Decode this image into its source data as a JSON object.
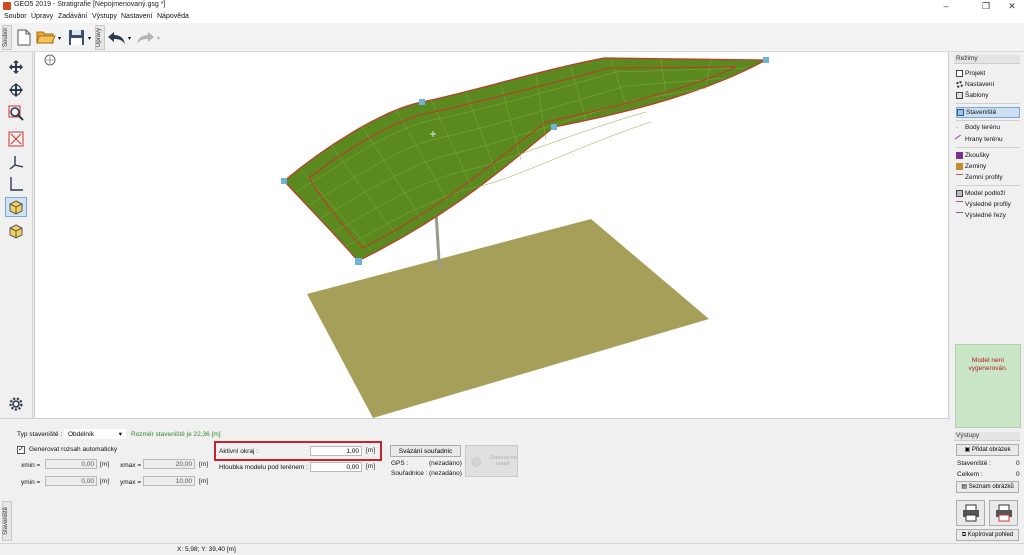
{
  "window": {
    "title": "GEO5 2019 - Stratigrafie [Nepojmenovaný.gsg *]"
  },
  "menu": [
    "Soubor",
    "Úpravy",
    "Zadávání",
    "Výstupy",
    "Nastavení",
    "Nápověda"
  ],
  "toolbar": {
    "tab_file": "Soubor",
    "tab_edit": "Úpravy"
  },
  "right_panel": {
    "header": "Režimy",
    "items": [
      {
        "label": "Projekt",
        "icon": "project-icon"
      },
      {
        "label": "Nastavení",
        "icon": "gear-icon"
      },
      {
        "label": "Šablony",
        "icon": "template-icon"
      },
      {
        "label": "Staveniště",
        "icon": "site-icon",
        "active": true
      },
      {
        "label": "Body terénu",
        "icon": "terrain-point-icon"
      },
      {
        "label": "Hrany terénu",
        "icon": "terrain-edge-icon"
      },
      {
        "label": "Zkoušky",
        "icon": "borehole-icon"
      },
      {
        "label": "Zeminy",
        "icon": "soil-icon"
      },
      {
        "label": "Zemní profily",
        "icon": "soil-profile-icon"
      },
      {
        "label": "Model podloží",
        "icon": "subsoil-model-icon"
      },
      {
        "label": "Výsledné profily",
        "icon": "result-profile-icon"
      },
      {
        "label": "Výsledné řezy",
        "icon": "result-section-icon"
      }
    ],
    "model_status": "Model není vygenerován."
  },
  "bottom_panel": {
    "vtab": "Staveniště",
    "site_type_label": "Typ staveniště :",
    "site_type_value": "Obdélník",
    "site_size_info": "Rozměr staveniště je 22,36 [m]",
    "auto_checkbox_label": "Generovat rozsah automaticky",
    "xmin_label": "xmin =",
    "xmin_value": "0,00",
    "xmax_label": "xmax =",
    "xmax_value": "20,00",
    "ymin_label": "ymin =",
    "ymin_value": "0,00",
    "ymax_label": "ymax =",
    "ymax_value": "10,00",
    "unit_m": "[m]",
    "active_margin_label": "Aktivní okraj :",
    "active_margin_value": "1,00",
    "depth_label": "Hloubka modelu pod terénem :",
    "depth_value": "0,00",
    "coords_button": "Svázání souřadnic",
    "gps_label": "GPS :",
    "gps_value": "(nezadáno)",
    "coords_label": "Souřadnice :",
    "coords_value": "(nezadáno)",
    "map_button": "Zobrazit na mapě"
  },
  "outputs_panel": {
    "header": "Výstupy",
    "add_image": "Přidat obrázek",
    "site_label": "Staveniště :",
    "site_count": "0",
    "total_label": "Celkem :",
    "total_count": "0",
    "image_list": "Seznam obrázků",
    "copy_view": "Kopírovat pohled"
  },
  "status": {
    "coordinates": "X: 5,98; Y: 39,40 [m]"
  },
  "colors": {
    "terrain": "#5a8a1f",
    "grid": "#7fae3a",
    "border": "#c0392b",
    "ground": "#a69f5a",
    "highlight": "#c8232c"
  }
}
